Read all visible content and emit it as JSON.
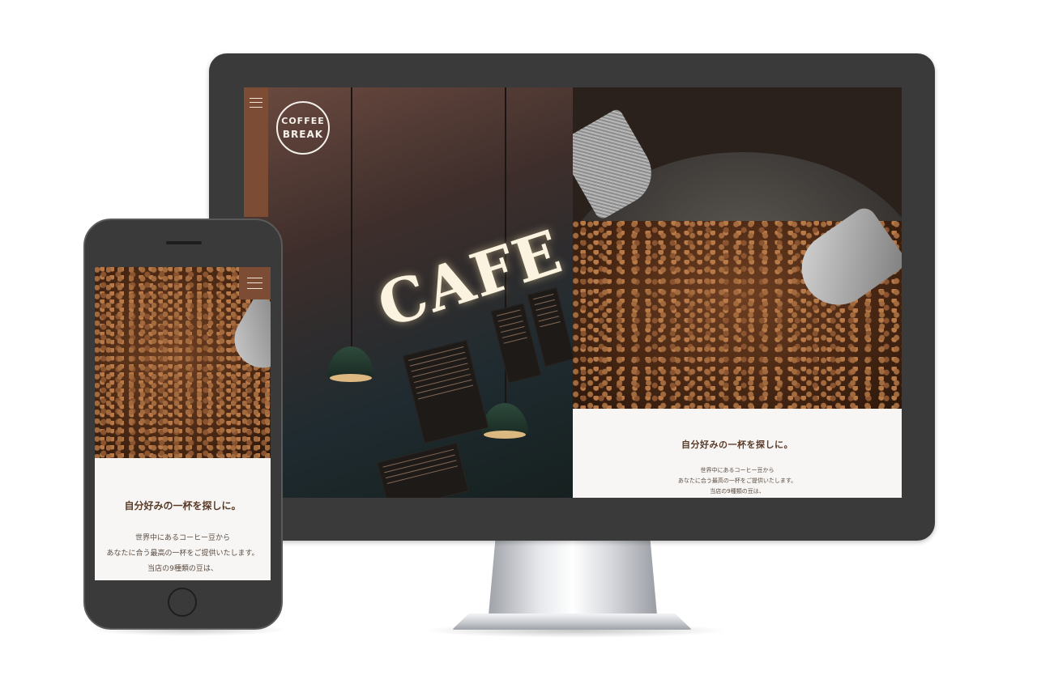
{
  "brand": {
    "logo_text_line1": "COFFEE",
    "logo_text_line2": "BREAK",
    "accent_color": "#7d4c35",
    "text_color": "#5a3a28"
  },
  "desktop": {
    "hero_sign": "CAFE",
    "menu_icon": "hamburger-menu-icon",
    "intro_heading": "自分好みの一杯を探しに。",
    "intro_lines": [
      "世界中にあるコーヒー豆から",
      "あなたに合う最高の一杯をご提供いたします。",
      "当店の9種類の豆は、"
    ]
  },
  "mobile": {
    "menu_icon": "hamburger-menu-icon",
    "intro_heading": "自分好みの一杯を探しに。",
    "intro_lines": [
      "世界中にあるコーヒー豆から",
      "あなたに合う最高の一杯をご提供いたします。",
      "当店の9種類の豆は、"
    ]
  }
}
